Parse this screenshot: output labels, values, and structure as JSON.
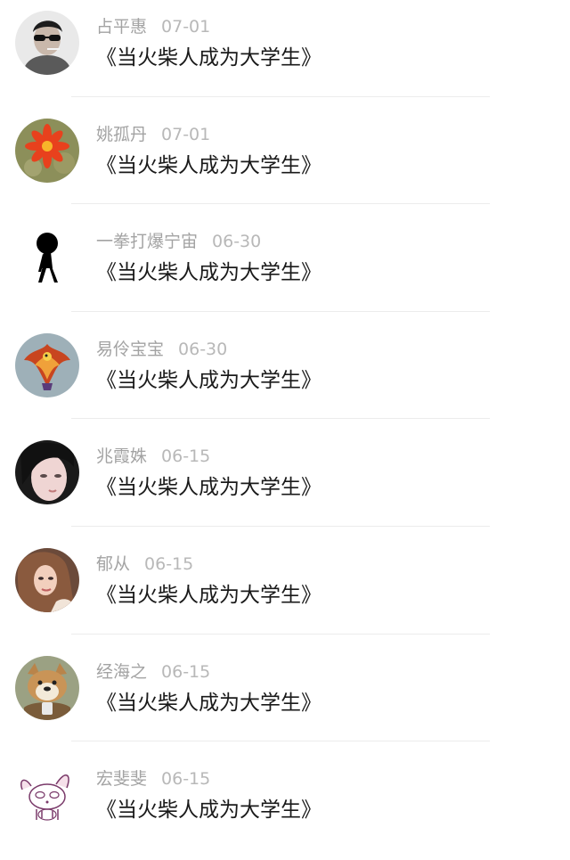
{
  "comments": [
    {
      "avatar": "man-sunglasses-avatar",
      "name": "占平惠",
      "date": "07-01",
      "title": "《当火柴人成为大学生》"
    },
    {
      "avatar": "cactus-flower-avatar",
      "name": "姚孤丹",
      "date": "07-01",
      "title": "《当火柴人成为大学生》"
    },
    {
      "avatar": "stick-figure-avatar",
      "name": "一拳打爆宁宙",
      "date": "06-30",
      "title": "《当火柴人成为大学生》"
    },
    {
      "avatar": "phoenix-avatar",
      "name": "易伶宝宝",
      "date": "06-30",
      "title": "《当火柴人成为大学生》"
    },
    {
      "avatar": "girl-face-avatar",
      "name": "兆霞姝",
      "date": "06-15",
      "title": "《当火柴人成为大学生》"
    },
    {
      "avatar": "woman-photo-avatar",
      "name": "郁从",
      "date": "06-15",
      "title": "《当火柴人成为大学生》"
    },
    {
      "avatar": "shiba-dog-avatar",
      "name": "经海之",
      "date": "06-15",
      "title": "《当火柴人成为大学生》"
    },
    {
      "avatar": "bunny-sketch-avatar",
      "name": "宏斐斐",
      "date": "06-15",
      "title": "《当火柴人成为大学生》"
    }
  ]
}
